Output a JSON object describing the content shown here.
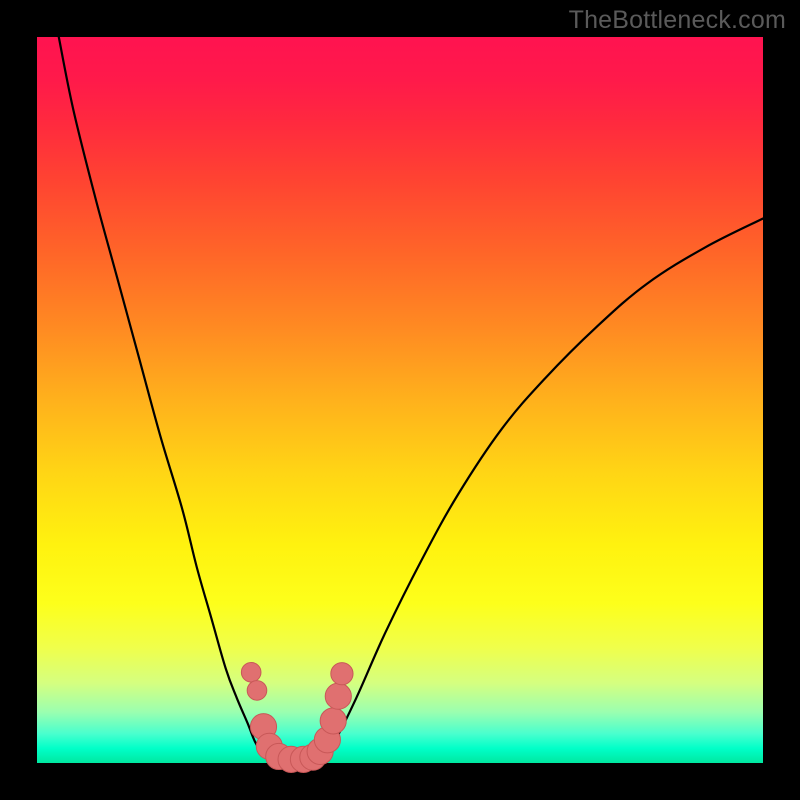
{
  "watermark": "TheBottleneck.com",
  "colors": {
    "curve": "#000000",
    "marker_fill": "#e07070",
    "marker_stroke": "#c85858",
    "frame": "#000000"
  },
  "chart_data": {
    "type": "line",
    "title": "",
    "xlabel": "",
    "ylabel": "",
    "xlim": [
      0,
      100
    ],
    "ylim": [
      0,
      100
    ],
    "legend": false,
    "grid": false,
    "series": [
      {
        "name": "left-branch",
        "x": [
          3,
          5,
          8,
          11,
          14,
          17,
          20,
          22,
          24,
          26,
          27.5,
          29,
          30,
          31,
          32
        ],
        "y": [
          100,
          90,
          78,
          67,
          56,
          45,
          35,
          27,
          20,
          13,
          9,
          5.5,
          3,
          1.4,
          0.6
        ]
      },
      {
        "name": "valley-floor",
        "x": [
          32,
          33.5,
          35,
          37,
          39
        ],
        "y": [
          0.6,
          0.35,
          0.25,
          0.3,
          0.6
        ]
      },
      {
        "name": "right-branch",
        "x": [
          39,
          41,
          44,
          48,
          53,
          58,
          64,
          70,
          77,
          84,
          92,
          100
        ],
        "y": [
          0.6,
          3,
          9,
          18,
          28,
          37,
          46,
          53,
          60,
          66,
          71,
          75
        ]
      }
    ],
    "markers": {
      "name": "valley-markers",
      "points": [
        {
          "x": 29.5,
          "y": 12.5,
          "r": 1.5
        },
        {
          "x": 30.3,
          "y": 10.0,
          "r": 1.5
        },
        {
          "x": 31.2,
          "y": 5.0,
          "r": 2.0
        },
        {
          "x": 32.0,
          "y": 2.3,
          "r": 2.0
        },
        {
          "x": 33.3,
          "y": 0.9,
          "r": 2.0
        },
        {
          "x": 35.0,
          "y": 0.5,
          "r": 2.0
        },
        {
          "x": 36.7,
          "y": 0.5,
          "r": 2.0
        },
        {
          "x": 38.0,
          "y": 0.8,
          "r": 2.0
        },
        {
          "x": 39.0,
          "y": 1.6,
          "r": 2.0
        },
        {
          "x": 40.0,
          "y": 3.2,
          "r": 2.0
        },
        {
          "x": 40.8,
          "y": 5.8,
          "r": 2.0
        },
        {
          "x": 41.5,
          "y": 9.2,
          "r": 2.0
        },
        {
          "x": 42.0,
          "y": 12.3,
          "r": 1.7
        }
      ]
    }
  }
}
